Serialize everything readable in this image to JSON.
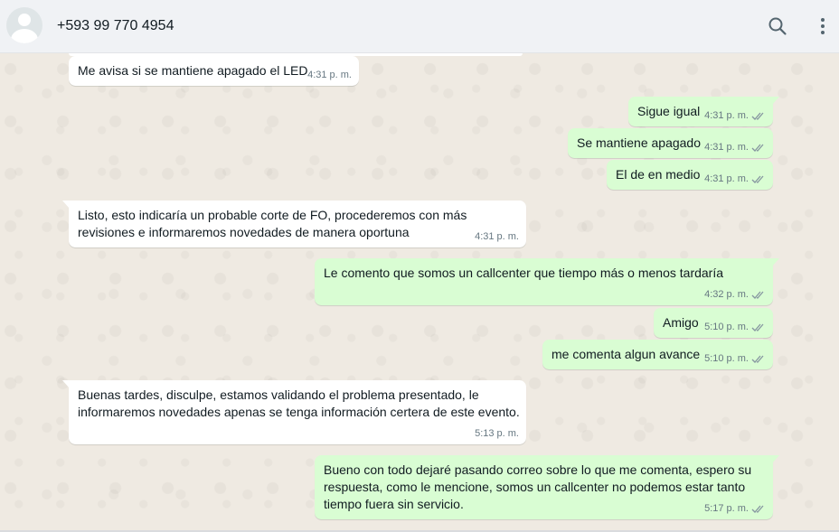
{
  "contact": {
    "name": "+593 99 770 4954"
  },
  "icons": {
    "avatar": "default-avatar-icon",
    "search": "search-icon",
    "menu": "vertical-dots-menu-icon",
    "read_receipt": "double-check-icon"
  },
  "colors": {
    "incoming_bubble": "#ffffff",
    "outgoing_bubble": "#d9fdd3",
    "header_bg": "#f0f2f5",
    "chat_bg": "#efeae2",
    "timestamp": "#667781",
    "read_ticks": "#8696a0"
  },
  "messages": [
    {
      "dir": "in",
      "text": "Me avisa si se mantiene apagado el LED",
      "time": "4:31 p. m."
    },
    {
      "dir": "out",
      "text": "Sigue igual",
      "time": "4:31 p. m."
    },
    {
      "dir": "out",
      "text": "Se mantiene apagado",
      "time": "4:31 p. m."
    },
    {
      "dir": "out",
      "text": "El de en medio",
      "time": "4:31 p. m."
    },
    {
      "dir": "in",
      "text": "Listo, esto indicaría un probable corte de FO, procederemos con más revisiones e informaremos novedades de manera oportuna",
      "time": "4:31 p. m."
    },
    {
      "dir": "out",
      "text": "Le comento que somos un callcenter que tiempo más o menos tardaría",
      "time": "4:32 p. m."
    },
    {
      "dir": "out",
      "text": "Amigo",
      "time": "5:10 p. m."
    },
    {
      "dir": "out",
      "text": "me comenta algun avance",
      "time": "5:10 p. m."
    },
    {
      "dir": "in",
      "text": "Buenas tardes, disculpe, estamos validando el problema presentado, le informaremos novedades apenas se tenga información certera de este evento.",
      "time": "5:13 p. m."
    },
    {
      "dir": "out",
      "text": "Bueno con todo dejaré pasando correo sobre lo que me comenta, espero su respuesta, como le mencione, somos un callcenter no podemos estar tanto tiempo fuera sin servicio.",
      "time": "5:17 p. m."
    }
  ]
}
